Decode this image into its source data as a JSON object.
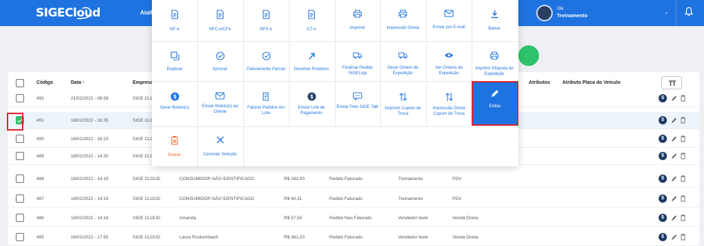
{
  "header": {
    "logo": "SIGECloud",
    "atalhos": "Atalh",
    "greeting": "Olá",
    "user": "Treinamento"
  },
  "table": {
    "columns": [
      "Código",
      "Data ↑",
      "Empresa",
      "Atributos",
      "Atributo Placa do Veículo"
    ],
    "rows": [
      {
        "code": "492",
        "date": "21/02/2022 - 08:58",
        "company": "SIGE CLOUD",
        "client": "",
        "value": "",
        "status": "",
        "seller": "",
        "origin": "",
        "checked": false
      },
      {
        "code": "491",
        "date": "18/02/2022 - 16:35",
        "company": "SIGE CLOUD",
        "client": "",
        "value": "",
        "status": "",
        "seller": "",
        "origin": "",
        "checked": true
      },
      {
        "code": "490",
        "date": "18/02/2022 - 16:23",
        "company": "SIGE CLOUD",
        "client": "",
        "value": "",
        "status": "",
        "seller": "",
        "origin": "",
        "checked": false
      },
      {
        "code": "489",
        "date": "18/02/2022 - 14:20",
        "company": "SIGE CLOUD",
        "client": "",
        "value": "",
        "status": "",
        "seller": "",
        "origin": "",
        "checked": false
      },
      {
        "code": "488",
        "date": "18/02/2022 - 14:19",
        "company": "SIGE CLOUD",
        "client": "CONSUMIDOR NÃO IDENTIFICADO",
        "value": "R$ 183,00",
        "status": "Pedido Faturado",
        "seller": "Treinamento",
        "origin": "PDV",
        "checked": false
      },
      {
        "code": "487",
        "date": "18/02/2022 - 14:19",
        "company": "SIGE CLOUD",
        "client": "CONSUMIDOR NÃO IDENTIFICADO",
        "value": "R$ 40,31",
        "status": "Pedido Faturado",
        "seller": "Treinamento",
        "origin": "PDV",
        "checked": false
      },
      {
        "code": "486",
        "date": "18/02/2022 - 14:16",
        "company": "SIGE CLOUD",
        "client": "Amanda",
        "value": "R$ 57,50",
        "status": "Pedido Nao Faturado",
        "seller": "Vendedor teste",
        "origin": "Venda Direta",
        "checked": false
      },
      {
        "code": "485",
        "date": "16/02/2022 - 17:55",
        "company": "SIGE CLOUD",
        "client": "Laura Rockembach",
        "value": "R$ 361,20",
        "status": "Pedido Faturado",
        "seller": "Vendedor teste",
        "origin": "Venda Direta",
        "checked": false
      }
    ]
  },
  "menu": {
    "row1": [
      "NF-e",
      "NFC-e/CFe",
      "NFS-e",
      "CT-e",
      "Imprimir",
      "Impressão Direta",
      "Enviar por E-mail",
      "Baixar"
    ],
    "row2": [
      "Duplicar",
      "Aprovar",
      "Faturamento Parcial",
      "Devolver Produtos",
      "Finalizar Pedido SIGELoja",
      "Gerar Ordem de Expedição",
      "Ver Ordens de Expedição",
      "Imprimir Etiqueta de Expedição"
    ],
    "row3": [
      "Gerar Boleto(s)",
      "Enviar Boleto(s) ao Cliente",
      "Faturar Pedidos em Lote",
      "Enviar Link de Pagamento",
      "Enviar Pelo SIGE Talk",
      "Imprimir Cupom de Troca",
      "Impressão Direta Cupom de Troca",
      "Editar"
    ],
    "row4": [
      "Excluir",
      "Cancelar Seleção"
    ]
  },
  "colors": {
    "primary": "#1f73e0",
    "danger": "#e8622a",
    "success": "#2ec26a",
    "highlight": "#e0212a"
  }
}
